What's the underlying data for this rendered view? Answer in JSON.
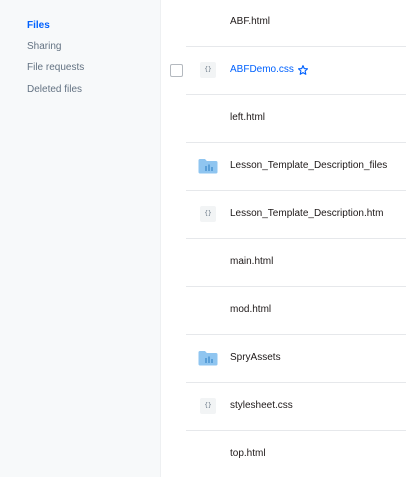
{
  "sidebar": {
    "items": [
      {
        "label": "Files"
      },
      {
        "label": "Sharing"
      },
      {
        "label": "File requests"
      },
      {
        "label": "Deleted files"
      }
    ]
  },
  "files": [
    {
      "name": "ABF.html",
      "type": "html"
    },
    {
      "name": "ABFDemo.css",
      "type": "code",
      "starred": true,
      "hovered": true
    },
    {
      "name": "left.html",
      "type": "html"
    },
    {
      "name": "Lesson_Template_Description_files",
      "type": "folder"
    },
    {
      "name": "Lesson_Template_Description.htm",
      "type": "code"
    },
    {
      "name": "main.html",
      "type": "html"
    },
    {
      "name": "mod.html",
      "type": "html"
    },
    {
      "name": "SpryAssets",
      "type": "folder"
    },
    {
      "name": "stylesheet.css",
      "type": "code"
    },
    {
      "name": "top.html",
      "type": "html"
    }
  ],
  "icons": {
    "code_glyph": "{}"
  },
  "colors": {
    "accent": "#0061fe",
    "folder": "#8fc5f0"
  }
}
